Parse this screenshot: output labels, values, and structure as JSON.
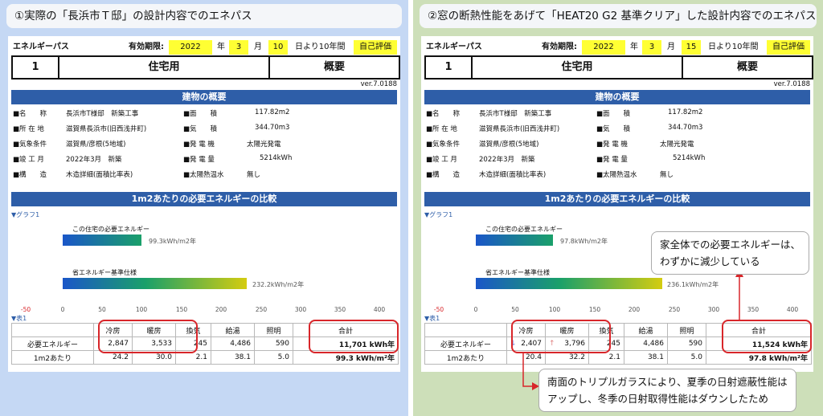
{
  "left": {
    "headline": "①実際の「長浜市Ｔ邸」の設計内容でのエネパス",
    "header": {
      "title": "エネルギーパス",
      "valid_label": "有効期限:",
      "year": "2022",
      "year_unit": "年",
      "month": "3",
      "month_unit": "月",
      "day": "10",
      "day_suffix": "日より10年間",
      "badge": "自己評価"
    },
    "row2": {
      "number": "1",
      "usage": "住宅用",
      "summary": "概要"
    },
    "version": "ver.7.0188",
    "overview_title": "建物の概要",
    "info": [
      [
        "■名　　称",
        "長浜市T様邸　新築工事",
        "■面　　積",
        "117.82m2"
      ],
      [
        "■所 在 地",
        "滋賀県長浜市(旧西浅井町)",
        "■気　　積",
        "344.70m3"
      ],
      [
        "■気象条件",
        "滋賀県/彦根(5地域)",
        "■発 電 機",
        "太陽光発電"
      ],
      [
        "■竣 工 月",
        "2022年3月　新築",
        "■発 電 量",
        "5214kWh"
      ],
      [
        "■構　　造",
        "木造詳細(面積比率表)",
        "■太陽熱温水",
        "無し"
      ]
    ],
    "compare_title": "1m2あたりの必要エネルギーの比較",
    "graph_label": "▼グラフ1",
    "bar1_label": "この住宅の必要エネルギー",
    "bar1_value": "99.3kWh/m2年",
    "bar1_fraction": 0.248,
    "bar2_label": "省エネルギー基準仕様",
    "bar2_value": "232.2kWh/m2年",
    "bar2_fraction": 0.58,
    "table_label": "▼表1",
    "table": {
      "headers": [
        "",
        "冷房",
        "暖房",
        "換気",
        "給湯",
        "照明",
        "合計"
      ],
      "rows": [
        [
          "必要エネルギー",
          "2,847",
          "3,533",
          "245",
          "4,486",
          "590",
          "11,701 kWh年"
        ],
        [
          "1m2あたり",
          "24.2",
          "30.0",
          "2.1",
          "38.1",
          "5.0",
          "99.3 kWh/m²年"
        ]
      ]
    }
  },
  "right": {
    "headline": "②窓の断熱性能をあげて「HEAT20 G2 基準クリア」した設計内容でのエネパス",
    "header": {
      "title": "エネルギーパス",
      "valid_label": "有効期限:",
      "year": "2022",
      "year_unit": "年",
      "month": "3",
      "month_unit": "月",
      "day": "15",
      "day_suffix": "日より10年間",
      "badge": "自己評価"
    },
    "row2": {
      "number": "1",
      "usage": "住宅用",
      "summary": "概要"
    },
    "version": "ver.7.0188",
    "overview_title": "建物の概要",
    "info": [
      [
        "■名　　称",
        "長浜市T様邸　新築工事",
        "■面　　積",
        "117.82m2"
      ],
      [
        "■所 在 地",
        "滋賀県長浜市(旧西浅井町)",
        "■気　　積",
        "344.70m3"
      ],
      [
        "■気象条件",
        "滋賀県/彦根(5地域)",
        "■発 電 機",
        "太陽光発電"
      ],
      [
        "■竣 工 月",
        "2022年3月　新築",
        "■発 電 量",
        "5214kWh"
      ],
      [
        "■構　　造",
        "木造詳細(面積比率表)",
        "■太陽熱温水",
        "無し"
      ]
    ],
    "compare_title": "1m2あたりの必要エネルギーの比較",
    "graph_label": "▼グラフ1",
    "bar1_label": "この住宅の必要エネルギー",
    "bar1_value": "97.8kWh/m2年",
    "bar1_fraction": 0.244,
    "bar2_label": "省エネルギー基準仕様",
    "bar2_value": "236.1kWh/m2年",
    "bar2_fraction": 0.59,
    "table_label": "▼表1",
    "table": {
      "headers": [
        "",
        "冷房",
        "暖房",
        "換気",
        "給湯",
        "照明",
        "合計"
      ],
      "rows": [
        [
          "必要エネルギー",
          "2,407",
          "3,796",
          "245",
          "4,486",
          "590",
          "11,524 kWh年"
        ],
        [
          "1m2あたり",
          "20.4",
          "32.2",
          "2.1",
          "38.1",
          "5.0",
          "97.8 kWh/m²年"
        ]
      ]
    },
    "callout_top": [
      "家全体での必要エネルギーは、",
      "わずかに減少している"
    ],
    "callout_bottom": [
      "南面のトリプルガラスにより、夏季の日射遮蔽性能は",
      "アップし、冬季の日射取得性能はダウンしたため"
    ]
  },
  "axis_ticks": [
    "-50",
    "0",
    "50",
    "100",
    "150",
    "200",
    "250",
    "300",
    "350",
    "400"
  ],
  "colors": {
    "accent_blue": "#2e5ea8",
    "highlight_yellow": "#ffff33",
    "circle_red": "#d8262a"
  }
}
